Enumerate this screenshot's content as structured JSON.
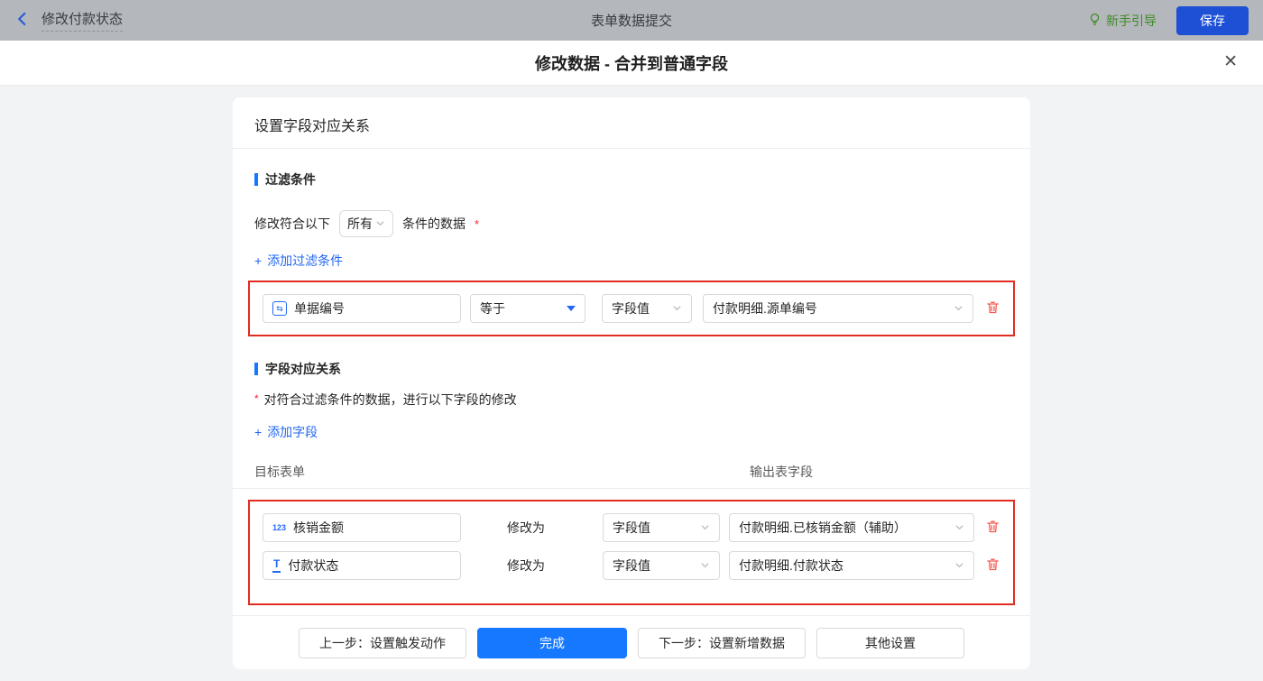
{
  "topbar": {
    "back_title": "修改付款状态",
    "center_title": "表单数据提交",
    "guide_label": "新手引导",
    "save_label": "保存"
  },
  "modal": {
    "title": "修改数据 - 合并到普通字段"
  },
  "icons": {
    "close": "✕",
    "plus": "+",
    "serial_field": "⇆",
    "number_field": "123",
    "text_field": "T"
  },
  "card": {
    "title": "设置字段对应关系",
    "filter": {
      "section_title": "过滤条件",
      "match_prefix": "修改符合以下",
      "match_mode": "所有",
      "match_suffix": "条件的数据",
      "required_mark": "*",
      "add_label": "添加过滤条件",
      "row": {
        "field": "单据编号",
        "operator": "等于",
        "value_type": "字段值",
        "value": "付款明细.源单编号"
      }
    },
    "mapping": {
      "section_title": "字段对应关系",
      "required_mark": "*",
      "description": "对符合过滤条件的数据，进行以下字段的修改",
      "add_label": "添加字段",
      "col_target": "目标表单",
      "col_output": "输出表字段",
      "rows": [
        {
          "field": "核销金额",
          "modify_label": "修改为",
          "value_type": "字段值",
          "value": "付款明细.已核销金额（辅助）"
        },
        {
          "field": "付款状态",
          "modify_label": "修改为",
          "value_type": "字段值",
          "value": "付款明细.付款状态"
        }
      ]
    },
    "footer": {
      "prev_label": "上一步：设置触发动作",
      "done_label": "完成",
      "next_label": "下一步：设置新增数据",
      "other_label": "其他设置"
    }
  },
  "colors": {
    "accent_blue": "#1677ff",
    "link_blue": "#2468f2",
    "highlight_red": "#e12d21",
    "danger_red": "#f5564e",
    "guide_green": "#3f8b27",
    "save_button_blue": "#1d50d5",
    "topbar_gray": "#b4b7bb"
  }
}
